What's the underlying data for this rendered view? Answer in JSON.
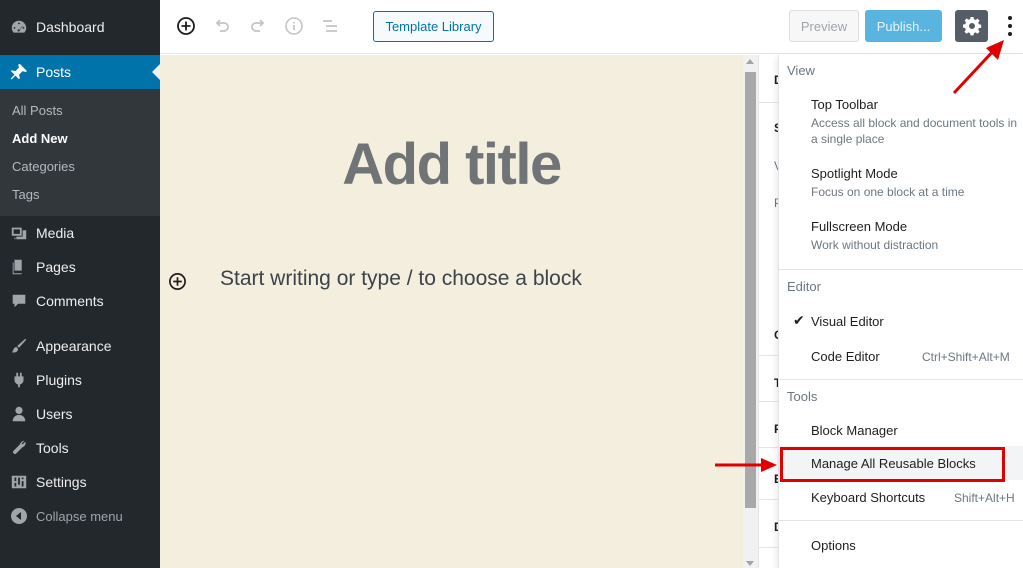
{
  "admin_menu": {
    "items": [
      {
        "label": "Dashboard",
        "icon": "dashboard-icon"
      },
      {
        "label": "Posts",
        "icon": "pin-icon"
      },
      {
        "label": "Media",
        "icon": "media-icon"
      },
      {
        "label": "Pages",
        "icon": "pages-icon"
      },
      {
        "label": "Comments",
        "icon": "comments-icon"
      },
      {
        "label": "Appearance",
        "icon": "brush-icon"
      },
      {
        "label": "Plugins",
        "icon": "plugin-icon"
      },
      {
        "label": "Users",
        "icon": "users-icon"
      },
      {
        "label": "Tools",
        "icon": "wrench-icon"
      },
      {
        "label": "Settings",
        "icon": "settings-sliders-icon"
      }
    ],
    "posts_submenu": [
      "All Posts",
      "Add New",
      "Categories",
      "Tags"
    ],
    "collapse_label": "Collapse menu"
  },
  "toolbar": {
    "template_library": "Template Library",
    "preview": "Preview",
    "publish": "Publish..."
  },
  "editor": {
    "title_placeholder": "Add title",
    "block_placeholder": "Start writing or type / to choose a block"
  },
  "dropdown": {
    "view_label": "View",
    "top_toolbar": {
      "title": "Top Toolbar",
      "desc": "Access all block and document tools in a single place"
    },
    "spotlight": {
      "title": "Spotlight Mode",
      "desc": "Focus on one block at a time"
    },
    "fullscreen": {
      "title": "Fullscreen Mode",
      "desc": "Work without distraction"
    },
    "editor_label": "Editor",
    "visual_editor": "Visual Editor",
    "code_editor": "Code Editor",
    "code_editor_shortcut": "Ctrl+Shift+Alt+M",
    "tools_label": "Tools",
    "block_manager": "Block Manager",
    "manage_reusable": "Manage All Reusable Blocks",
    "keyboard_shortcuts": "Keyboard Shortcuts",
    "keyboard_shortcuts_key": "Shift+Alt+H",
    "options": "Options"
  },
  "settings_panel_letters": [
    "D",
    "S",
    "V",
    "P",
    "C",
    "T",
    "F",
    "E",
    "D"
  ],
  "colors": {
    "admin_bg": "#23282d",
    "current_menu": "#0073aa",
    "canvas_bg": "#f4eedf",
    "highlight_red": "#e00000",
    "publish_blue": "#5ab4e0"
  }
}
